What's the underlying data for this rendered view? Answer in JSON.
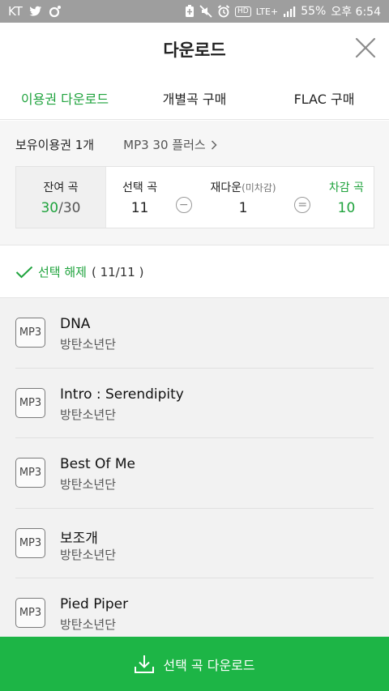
{
  "status_bar": {
    "carrier": "KT",
    "left_icons": [
      "twitter-icon",
      "circle-app-icon"
    ],
    "right_icons": [
      "battery-saver-icon",
      "mute-icon",
      "alarm-icon",
      "hd-icon",
      "lte-icon",
      "signal-icon"
    ],
    "lte_label": "LTE+",
    "hd_label": "HD",
    "battery": "55%",
    "time": "오후 6:54"
  },
  "header": {
    "title": "다운로드"
  },
  "tabs": [
    {
      "label": "이용권 다운로드",
      "active": true
    },
    {
      "label": "개별곡 구매",
      "active": false
    },
    {
      "label": "FLAC 구매",
      "active": false
    }
  ],
  "pass": {
    "owned_label": "보유이용권 1개",
    "pass_name": "MP3 30 플러스",
    "remaining": {
      "label": "잔여 곡",
      "value": "30",
      "total": "30"
    },
    "selected": {
      "label": "선택 곡",
      "value": "11"
    },
    "redownload": {
      "label": "재다운",
      "note": "(미차감)",
      "value": "1"
    },
    "deducted": {
      "label": "차감 곡",
      "value": "10"
    },
    "minus_symbol": "−",
    "equals_symbol": "="
  },
  "selection": {
    "label": "선택 해제",
    "count": "( 11/11 )"
  },
  "songs": [
    {
      "badge": "MP3",
      "title": "DNA",
      "artist": "방탄소년단"
    },
    {
      "badge": "MP3",
      "title": "Intro : Serendipity",
      "artist": "방탄소년단"
    },
    {
      "badge": "MP3",
      "title": "Best Of Me",
      "artist": "방탄소년단"
    },
    {
      "badge": "MP3",
      "title": "보조개",
      "artist": "방탄소년단"
    },
    {
      "badge": "MP3",
      "title": "Pied Piper",
      "artist": "방탄소년단"
    }
  ],
  "download_button": {
    "label": "선택 곡 다운로드"
  },
  "colors": {
    "accent": "#1fa33d",
    "button": "#1db546",
    "status_bar": "#9e9e9e"
  }
}
